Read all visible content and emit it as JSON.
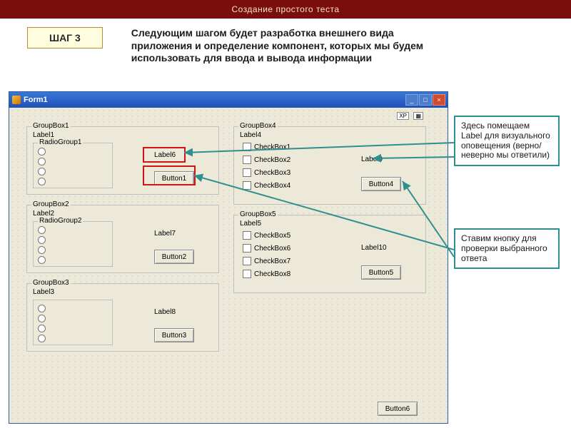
{
  "header": {
    "title": "Создание простого теста",
    "step": "ШАГ 3",
    "description": "Следующим шагом будет разработка внешнего вида приложения и определение компонент, которых мы будем использовать для ввода и вывода информации"
  },
  "window": {
    "title": "Form1",
    "xp": "XP"
  },
  "group1": {
    "name": "GroupBox1",
    "label": "Label1",
    "radiogroup": "RadioGroup1",
    "label_right": "Label6",
    "button": "Button1"
  },
  "group2": {
    "name": "GroupBox2",
    "label": "Label2",
    "radiogroup": "RadioGroup2",
    "label_right": "Label7",
    "button": "Button2"
  },
  "group3": {
    "name": "GroupBox3",
    "label": "Label3",
    "radiogroup": "",
    "label_right": "Label8",
    "button": "Button3"
  },
  "group4": {
    "name": "GroupBox4",
    "label": "Label4",
    "checks": [
      "CheckBox1",
      "CheckBox2",
      "CheckBox3",
      "CheckBox4"
    ],
    "label_right": "Label9",
    "button": "Button4"
  },
  "group5": {
    "name": "GroupBox5",
    "label": "Label5",
    "checks": [
      "CheckBox5",
      "CheckBox6",
      "CheckBox7",
      "CheckBox8"
    ],
    "label_right": "Label10",
    "button": "Button5"
  },
  "button6": "Button6",
  "annotations": {
    "a1": "Здесь помещаем Label для визуального оповещения (верно/неверно мы ответили)",
    "a2": "Ставим кнопку для проверки выбранного ответа"
  }
}
